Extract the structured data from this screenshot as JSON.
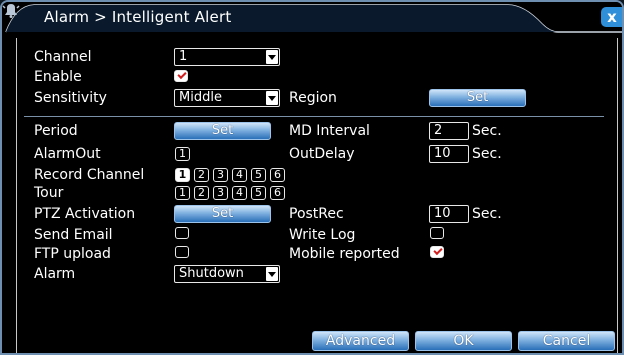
{
  "window": {
    "title": "Alarm > Intelligent Alert",
    "close_label": "x"
  },
  "form": {
    "channel": {
      "label": "Channel",
      "value": "1"
    },
    "enable": {
      "label": "Enable",
      "checked": true
    },
    "sensitivity": {
      "label": "Sensitivity",
      "value": "Middle"
    },
    "region": {
      "label": "Region",
      "button": "Set"
    },
    "period": {
      "label": "Period",
      "button": "Set"
    },
    "md_interval": {
      "label": "MD Interval",
      "value": "2",
      "unit": "Sec."
    },
    "alarm_out": {
      "label": "AlarmOut",
      "channels": [
        "1"
      ]
    },
    "out_delay": {
      "label": "OutDelay",
      "value": "10",
      "unit": "Sec."
    },
    "record_channel": {
      "label": "Record Channel",
      "channels": [
        "1",
        "2",
        "3",
        "4",
        "5",
        "6"
      ],
      "selected": [
        "1"
      ]
    },
    "tour": {
      "label": "Tour",
      "channels": [
        "1",
        "2",
        "3",
        "4",
        "5",
        "6"
      ]
    },
    "ptz_activation": {
      "label": "PTZ Activation",
      "button": "Set"
    },
    "post_rec": {
      "label": "PostRec",
      "value": "10",
      "unit": "Sec."
    },
    "send_email": {
      "label": "Send Email",
      "checked": false
    },
    "write_log": {
      "label": "Write Log",
      "checked": false
    },
    "ftp_upload": {
      "label": "FTP upload",
      "checked": false
    },
    "mobile_reported": {
      "label": "Mobile reported",
      "checked": true
    },
    "alarm": {
      "label": "Alarm",
      "value": "Shutdown"
    }
  },
  "footer": {
    "advanced": "Advanced",
    "ok": "OK",
    "cancel": "Cancel"
  },
  "colors": {
    "accent": "#2f8fd8",
    "frame": "#6f8fb0",
    "check": "#d02020"
  }
}
